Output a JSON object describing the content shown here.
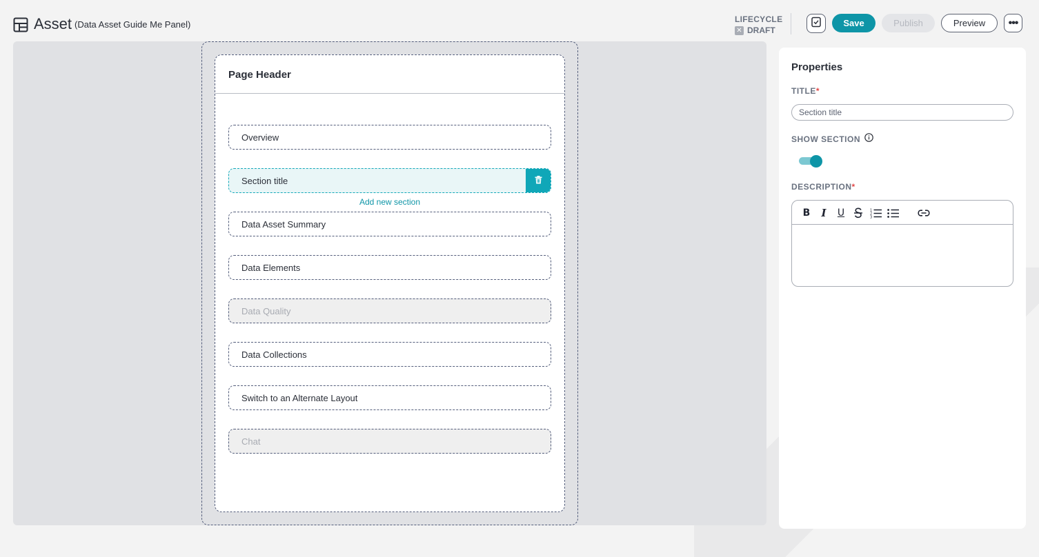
{
  "header": {
    "title": "Asset",
    "subtitle": "(Data Asset Guide Me Panel)",
    "lifecycle_label": "LIFECYCLE",
    "lifecycle_state": "DRAFT",
    "save_label": "Save",
    "publish_label": "Publish",
    "preview_label": "Preview"
  },
  "canvas": {
    "page_header": "Page Header",
    "add_section_label": "Add new section",
    "sections": [
      {
        "label": "Overview",
        "state": "normal"
      },
      {
        "label": "Section title",
        "state": "selected"
      },
      {
        "label": "Data Asset Summary",
        "state": "normal"
      },
      {
        "label": "Data Elements",
        "state": "normal"
      },
      {
        "label": "Data Quality",
        "state": "disabled"
      },
      {
        "label": "Data Collections",
        "state": "normal"
      },
      {
        "label": "Switch to an Alternate Layout",
        "state": "normal"
      },
      {
        "label": "Chat",
        "state": "disabled"
      }
    ]
  },
  "properties": {
    "title": "Properties",
    "title_field_label": "TITLE",
    "title_field_value": "Section title",
    "show_section_label": "SHOW SECTION",
    "show_section_on": true,
    "description_label": "DESCRIPTION",
    "required_mark": "*",
    "toolbar_icons": [
      "bold-icon",
      "italic-icon",
      "underline-icon",
      "strikethrough-icon",
      "ordered-list-icon",
      "bullet-list-icon",
      "link-icon"
    ]
  },
  "colors": {
    "accent": "#0e95a7",
    "selected_bg": "#e9f6f7",
    "required": "#e24848"
  }
}
